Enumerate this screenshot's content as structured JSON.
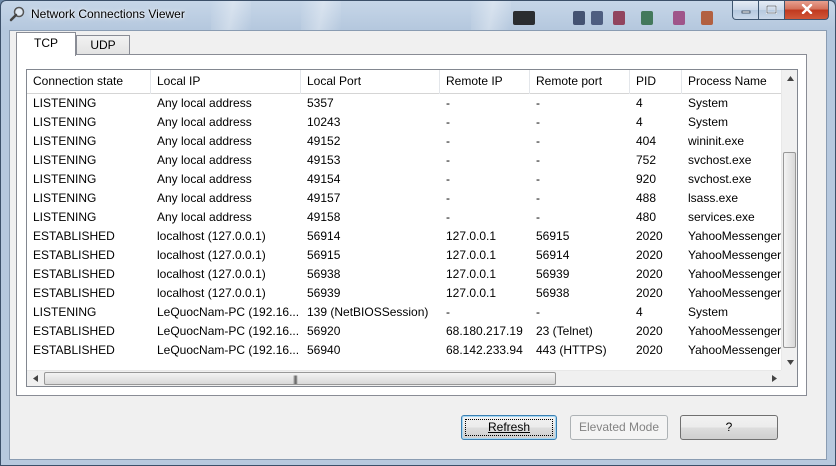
{
  "window": {
    "title": "Network Connections Viewer"
  },
  "tabs": [
    {
      "label": "TCP",
      "active": true
    },
    {
      "label": "UDP",
      "active": false
    }
  ],
  "table": {
    "columns": [
      "Connection state",
      "Local IP",
      "Local Port",
      "Remote IP",
      "Remote port",
      "PID",
      "Process Name"
    ],
    "rows": [
      [
        "LISTENING",
        "Any local address",
        "5357",
        "-",
        "-",
        "4",
        "System"
      ],
      [
        "LISTENING",
        "Any local address",
        "10243",
        "-",
        "-",
        "4",
        "System"
      ],
      [
        "LISTENING",
        "Any local address",
        "49152",
        "-",
        "-",
        "404",
        "wininit.exe"
      ],
      [
        "LISTENING",
        "Any local address",
        "49153",
        "-",
        "-",
        "752",
        "svchost.exe"
      ],
      [
        "LISTENING",
        "Any local address",
        "49154",
        "-",
        "-",
        "920",
        "svchost.exe"
      ],
      [
        "LISTENING",
        "Any local address",
        "49157",
        "-",
        "-",
        "488",
        "lsass.exe"
      ],
      [
        "LISTENING",
        "Any local address",
        "49158",
        "-",
        "-",
        "480",
        "services.exe"
      ],
      [
        "ESTABLISHED",
        "localhost (127.0.0.1)",
        "56914",
        "127.0.0.1",
        "56915",
        "2020",
        "YahooMessenger.exe"
      ],
      [
        "ESTABLISHED",
        "localhost (127.0.0.1)",
        "56915",
        "127.0.0.1",
        "56914",
        "2020",
        "YahooMessenger.exe"
      ],
      [
        "ESTABLISHED",
        "localhost (127.0.0.1)",
        "56938",
        "127.0.0.1",
        "56939",
        "2020",
        "YahooMessenger.exe"
      ],
      [
        "ESTABLISHED",
        "localhost (127.0.0.1)",
        "56939",
        "127.0.0.1",
        "56938",
        "2020",
        "YahooMessenger.exe"
      ],
      [
        "LISTENING",
        "LeQuocNam-PC (192.16...",
        "139 (NetBIOSSession)",
        "-",
        "-",
        "4",
        "System"
      ],
      [
        "ESTABLISHED",
        "LeQuocNam-PC (192.16...",
        "56920",
        "68.180.217.19",
        "23 (Telnet)",
        "2020",
        "YahooMessenger.exe"
      ],
      [
        "ESTABLISHED",
        "LeQuocNam-PC (192.16...",
        "56940",
        "68.142.233.94",
        "443 (HTTPS)",
        "2020",
        "YahooMessenger.exe"
      ]
    ]
  },
  "buttons": {
    "refresh": "Refresh",
    "elevated_mode": "Elevated Mode",
    "help": "?"
  },
  "icons": {
    "app": "network-magnifier-icon",
    "minimize": "minimize-icon",
    "maximize": "maximize-icon",
    "close": "close-icon",
    "scroll_up": "scroll-up-arrow-icon",
    "scroll_down": "scroll-down-arrow-icon",
    "scroll_left": "scroll-left-arrow-icon",
    "scroll_right": "scroll-right-arrow-icon"
  },
  "colors": {
    "frame": "#b7c9de",
    "close_button": "#c0391f",
    "default_button_border": "#3c7fb1",
    "disabled_text": "#838383"
  }
}
